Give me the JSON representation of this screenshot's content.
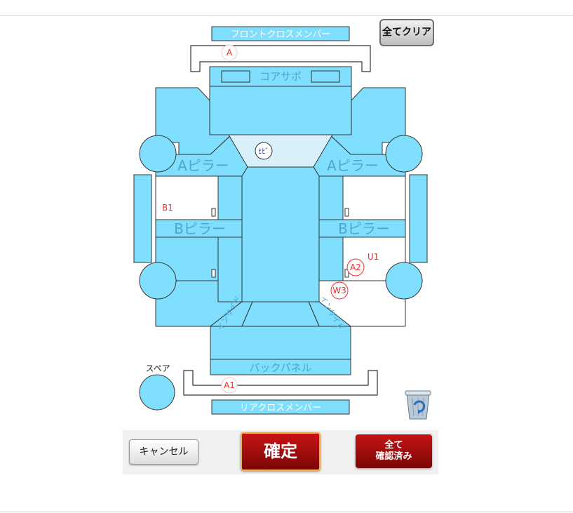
{
  "labels": {
    "front_cross_member": "フロントクロスメンバー",
    "core_support": "コアサポ",
    "a_pillar_left": "Aピラー",
    "a_pillar_right": "Aピラー",
    "b_pillar_left": "Bピラー",
    "b_pillar_right": "Bピラー",
    "inside_sill_left": "インサイド",
    "inside_sill_right": "インサイド",
    "back_panel": "バックパネル",
    "rear_cross_member": "リアクロスメンバー",
    "spare": "スペア"
  },
  "marks": {
    "front_a": "A",
    "roof_hibi": "ﾋﾋﾞ",
    "b1": "B1",
    "u1": "U1",
    "a2": "A2",
    "w3": "W3",
    "rear_a1": "A1"
  },
  "buttons": {
    "clear_all": "全てクリア",
    "cancel": "キャンセル",
    "confirm": "確定",
    "all_confirmed_line1": "全て",
    "all_confirmed_line2": "確認済み"
  },
  "icons": {
    "trash": "recycle-bin-icon"
  },
  "colors": {
    "panel_fill": "#80dfff",
    "panel_stroke": "#333333",
    "windshield": "#d9f1fb",
    "label_text": "#4aa8cc",
    "mark_red": "#e8302c",
    "confirm_red": "#b01010"
  }
}
